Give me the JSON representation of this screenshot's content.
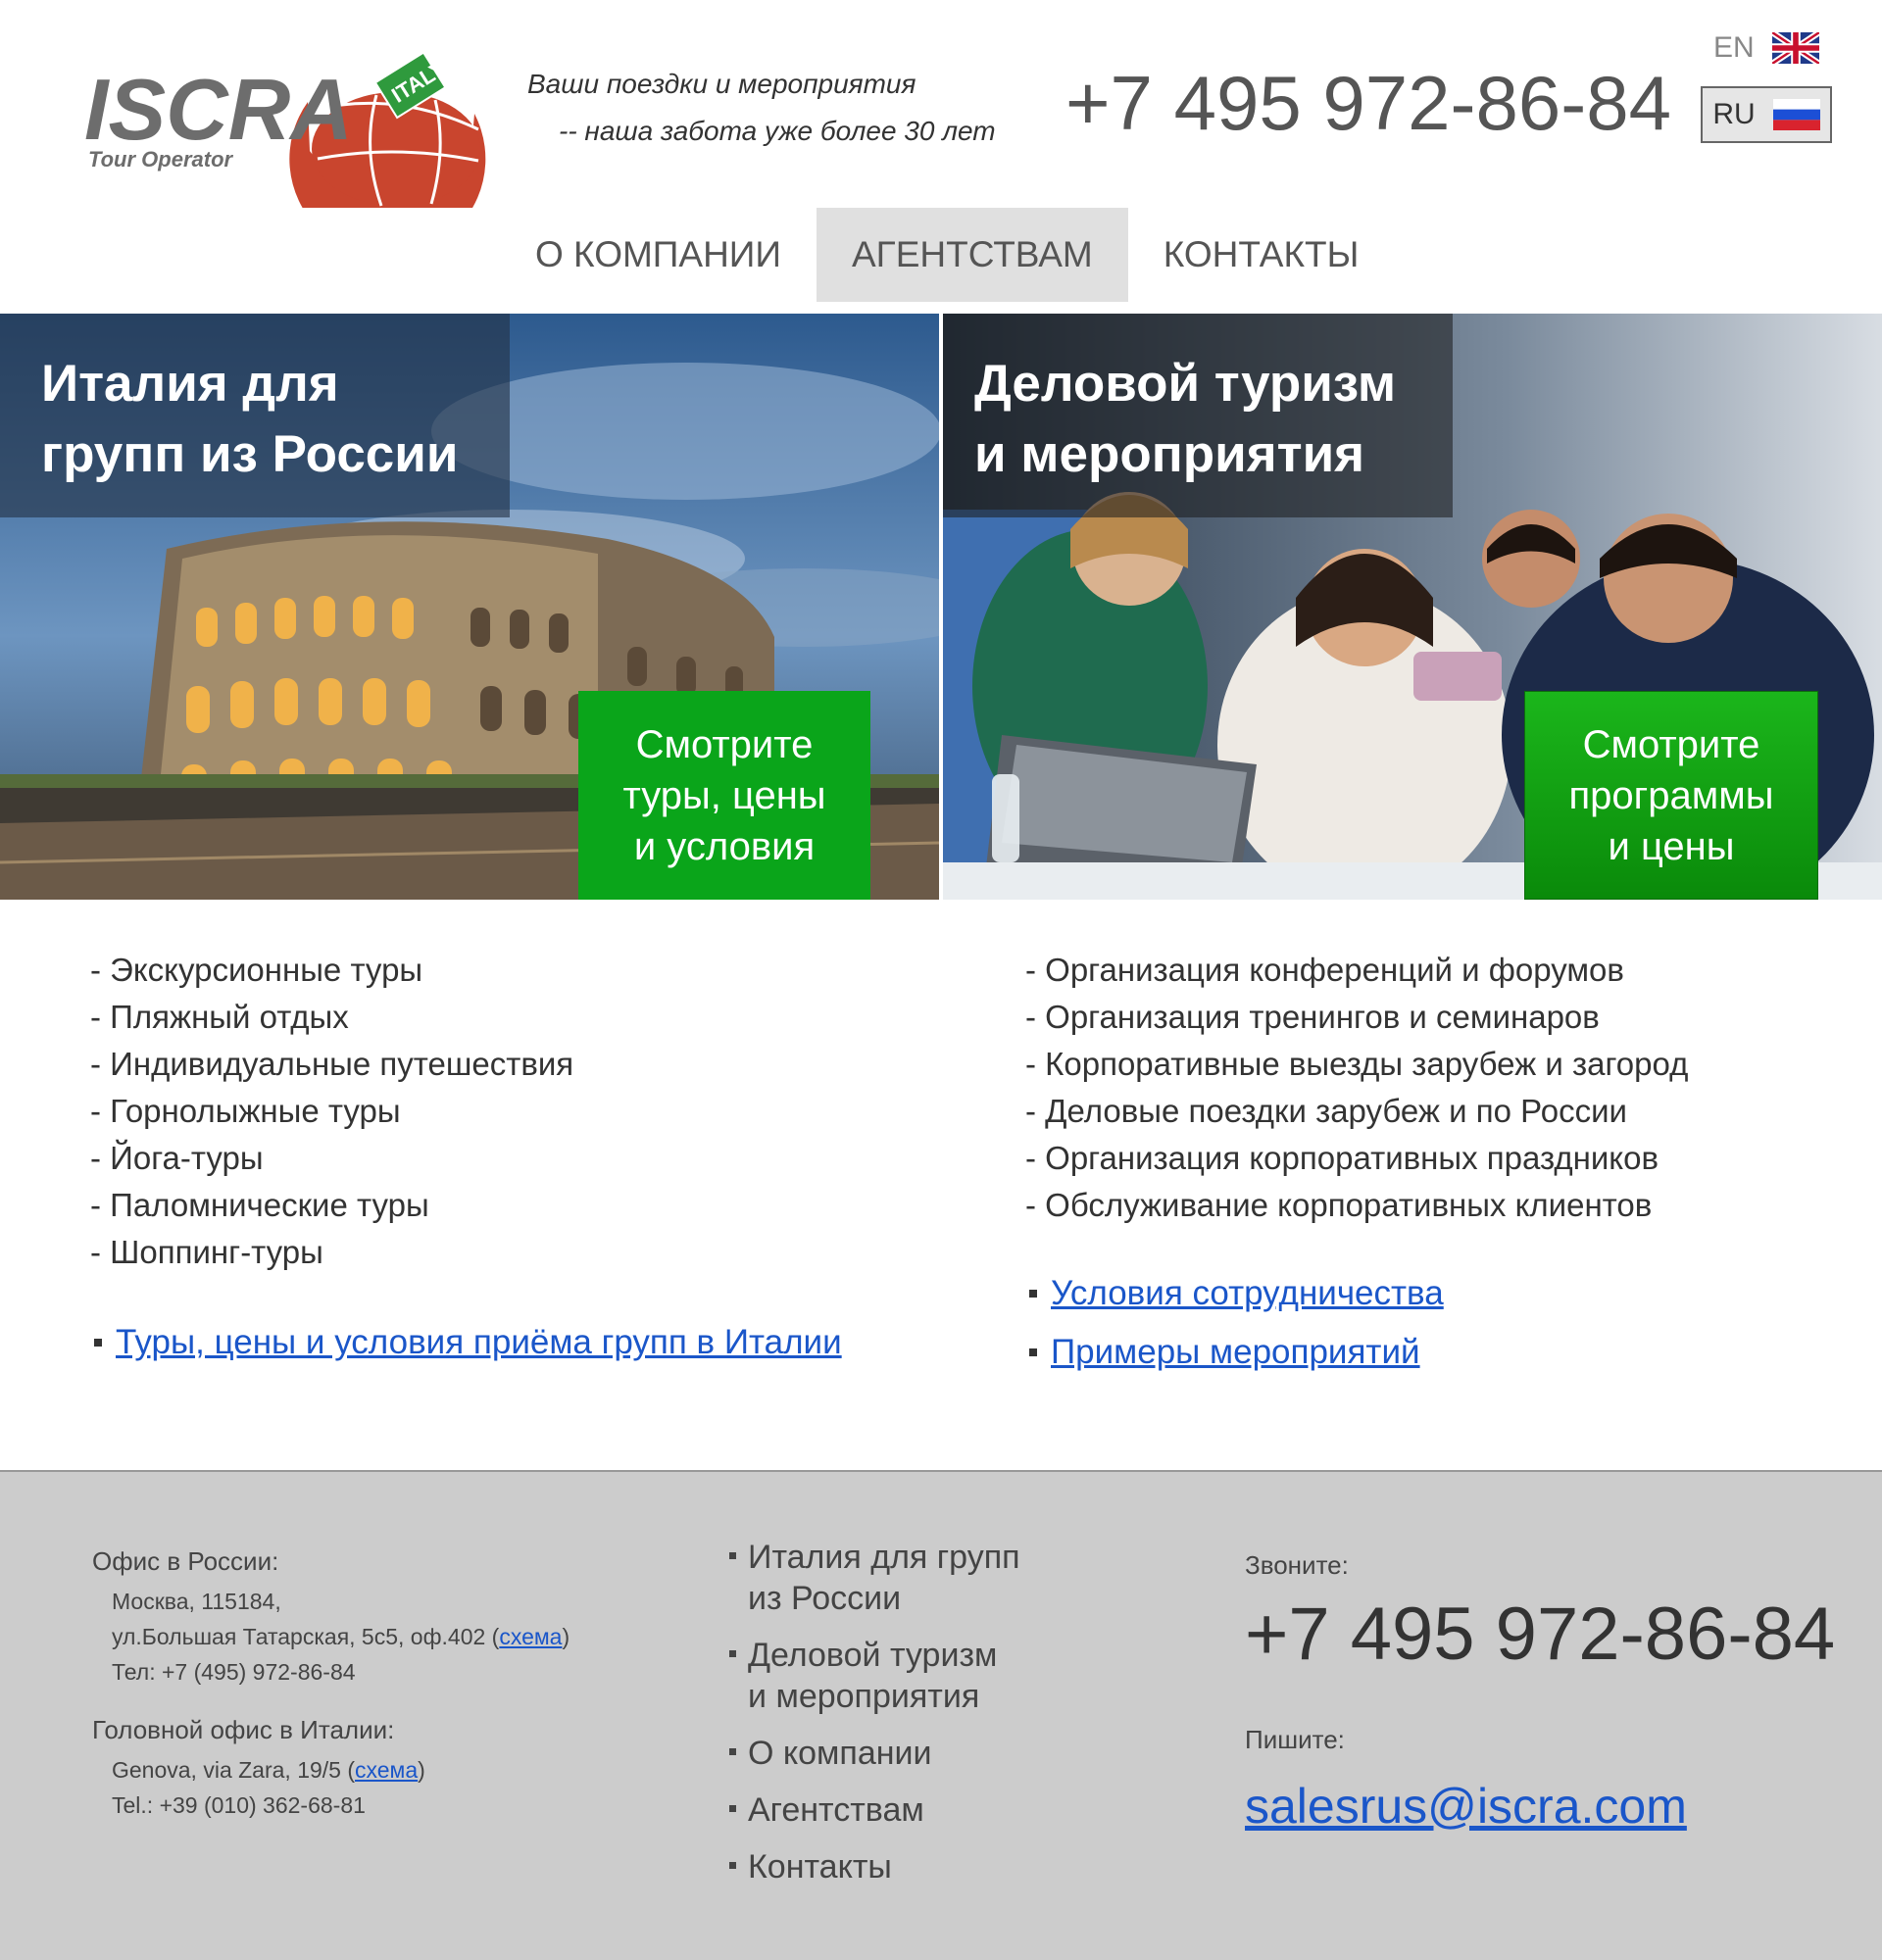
{
  "header": {
    "logo": {
      "brand": "ISCRA",
      "sub": "Tour Operator",
      "badge": "ITALY",
      "colors": {
        "gray": "#6d6d6d",
        "red": "#c9452e",
        "green": "#2f9a3d"
      }
    },
    "tagline_line1": "Ваши поездки и мероприятия",
    "tagline_line2": "-- наша забота уже более 30 лет",
    "phone": "+7 495 972-86-84",
    "lang_en": "EN",
    "lang_ru": "RU"
  },
  "nav": [
    {
      "label": "О КОМПАНИИ",
      "active": false
    },
    {
      "label": "АГЕНТСТВАМ",
      "active": true
    },
    {
      "label": "КОНТАКТЫ",
      "active": false
    }
  ],
  "banners": {
    "left": {
      "title_line1": "Италия для",
      "title_line2": "групп из России",
      "cta": "Смотрите\nтуры, цены\nи условия",
      "image": "colosseum-photo"
    },
    "right": {
      "title_line1": "Деловой туризм",
      "title_line2": "и мероприятия",
      "cta": "Смотрите\nпрограммы\nи цены",
      "image": "business-event-photo"
    }
  },
  "list_left": [
    "- Экскурсионные туры",
    "- Пляжный отдых",
    "- Индивидуальные путешествия",
    "- Горнолыжные туры",
    "- Йога-туры",
    "- Паломнические туры",
    "- Шоппинг-туры"
  ],
  "list_right": [
    "- Организация конференций и форумов",
    "- Организация тренингов и семинаров",
    "- Корпоративные выезды зарубеж и загород",
    "- Деловые поездки зарубеж и по России",
    "- Организация корпоративных праздников",
    "- Обслуживание корпоративных клиентов"
  ],
  "links_left": [
    "Туры, цены и условия приёма групп в Италии"
  ],
  "links_right": [
    "Условия сотрудничества",
    "Примеры мероприятий"
  ],
  "footer": {
    "office_ru_heading": "Офис в России:",
    "office_ru_line1": "Москва, 115184,",
    "office_ru_line2_pre": "ул.Большая Татарская, 5с5, оф.402 (",
    "office_ru_link": "схема",
    "office_ru_line2_post": ")",
    "office_ru_phone": "Тел: +7 (495) 972-86-84",
    "office_it_heading": "Головной офис в Италии:",
    "office_it_line1_pre": "Genova, via Zara, 19/5 (",
    "office_it_link": "схема",
    "office_it_line1_post": ")",
    "office_it_phone": "Tel.: +39 (010) 362-68-81",
    "nav": [
      {
        "line1": "Италия для групп",
        "line2": "из России"
      },
      {
        "line1": "Деловой туризм",
        "line2": "и мероприятия"
      },
      {
        "line1": "О компании",
        "line2": ""
      },
      {
        "line1": "Агентствам",
        "line2": ""
      },
      {
        "line1": "Контакты",
        "line2": ""
      }
    ],
    "call_heading": "Звоните:",
    "phone": "+7 495 972-86-84",
    "write_heading": "Пишите:",
    "email": "salesrus@iscra.com"
  },
  "colors": {
    "cta_green": "#0aa51a",
    "nav_active_bg": "#e0e0e0",
    "footer_bg": "#cccccc",
    "link": "#1a56c9"
  }
}
